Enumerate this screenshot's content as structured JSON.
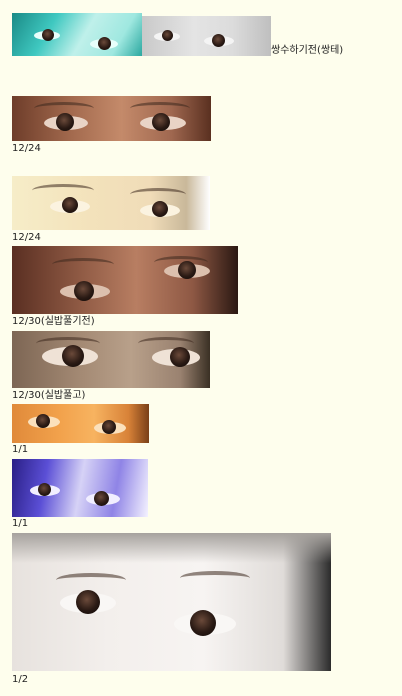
{
  "captions": {
    "first": "쌍수하기전(쌍테)",
    "p2": "12/24",
    "p3": "12/24",
    "p4": "12/30(실밥풀기전)",
    "p5": "12/30(실밥풀고)",
    "p6": "1/1",
    "p7": "1/1",
    "p8": "1/2"
  }
}
